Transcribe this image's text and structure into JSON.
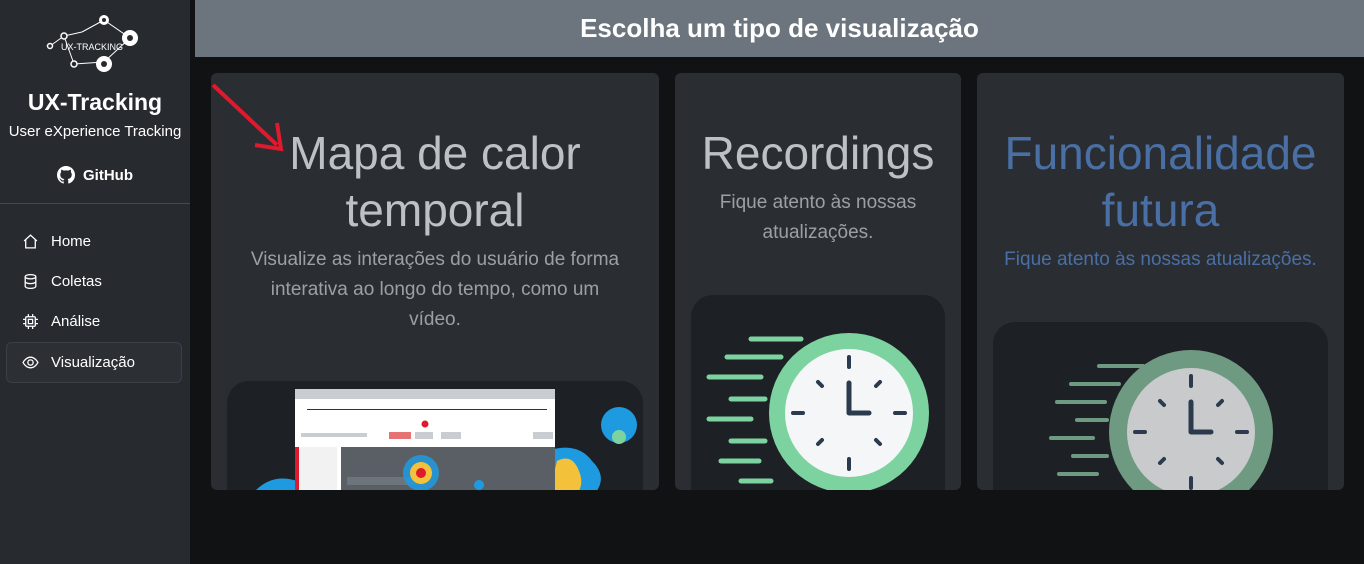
{
  "sidebar": {
    "logo_text": "UX-TRACKING",
    "brand": "UX-Tracking",
    "tagline": "User eXperience Tracking",
    "github_label": "GitHub",
    "items": [
      {
        "label": "Home",
        "icon": "house-icon"
      },
      {
        "label": "Coletas",
        "icon": "database-icon"
      },
      {
        "label": "Análise",
        "icon": "cpu-icon"
      },
      {
        "label": "Visualização",
        "icon": "eye-icon",
        "active": true
      }
    ]
  },
  "header": {
    "title": "Escolha um tipo de visualização"
  },
  "cards": [
    {
      "title_line1": "Mapa de calor",
      "title_line2": "temporal",
      "text_line1": "Visualize as interações do usuário de forma",
      "text_line2": "interativa ao longo do tempo, como um",
      "text_line3": "vídeo."
    },
    {
      "title": "Recordings",
      "text_line1": "Fique atento às nossas",
      "text_line2": "atualizações."
    },
    {
      "title_line1": "Funcionalidade",
      "title_line2": "futura",
      "text": "Fique atento às nossas atualizações."
    }
  ],
  "colors": {
    "sidebar_bg": "#272b30",
    "header_bg": "#6c757d",
    "card_bg": "#2a2e33",
    "future_accent": "#4a6fa5",
    "clock_green": "#7dd3a0",
    "arrow_red": "#e0192d"
  }
}
